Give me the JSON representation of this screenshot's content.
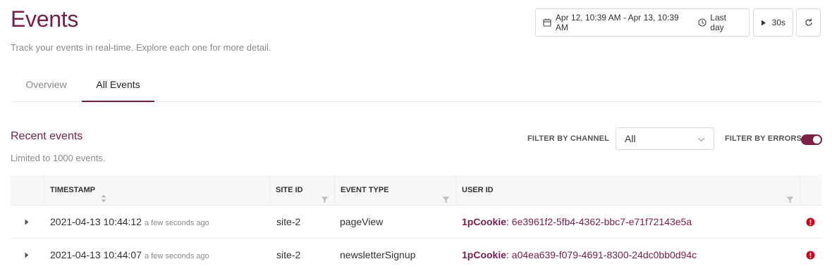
{
  "header": {
    "title": "Events",
    "subtitle": "Track your events in real-time. Explore each one for more detail.",
    "date_range": "Apr 12, 10:39 AM - Apr 13, 10:39 AM",
    "range_preset": "Last day",
    "refresh_interval": "30s"
  },
  "tabs": [
    {
      "label": "Overview",
      "active": false
    },
    {
      "label": "All Events",
      "active": true
    }
  ],
  "section": {
    "title": "Recent events",
    "subtitle": "Limited to 1000 events.",
    "filter_channel_label": "FILTER BY CHANNEL",
    "filter_channel_value": "All",
    "filter_errors_label": "FILTER BY ERRORS",
    "filter_errors_on": true
  },
  "table": {
    "columns": {
      "timestamp": "TIMESTAMP",
      "site_id": "SITE ID",
      "event_type": "EVENT TYPE",
      "user_id": "USER ID"
    },
    "rows": [
      {
        "timestamp": "2021-04-13 10:44:12",
        "ago": "a few seconds ago",
        "site_id": "site-2",
        "event_type": "pageView",
        "user_key": "1pCookie",
        "user_value": ": 6e3961f2-5fb4-4362-bbc7-e71f72143e5a"
      },
      {
        "timestamp": "2021-04-13 10:44:07",
        "ago": "a few seconds ago",
        "site_id": "site-2",
        "event_type": "newsletterSignup",
        "user_key": "1pCookie",
        "user_value": ": a04ea639-f079-4691-8300-24dc0bb0d94c"
      }
    ]
  },
  "colors": {
    "accent": "#7a1f45",
    "error": "#d0021b"
  },
  "icons": [
    "calendar-icon",
    "clock-icon",
    "play-icon",
    "refresh-icon",
    "chevron-down-icon",
    "sort-icon",
    "filter-icon",
    "expand-arrow-icon",
    "error-icon"
  ]
}
